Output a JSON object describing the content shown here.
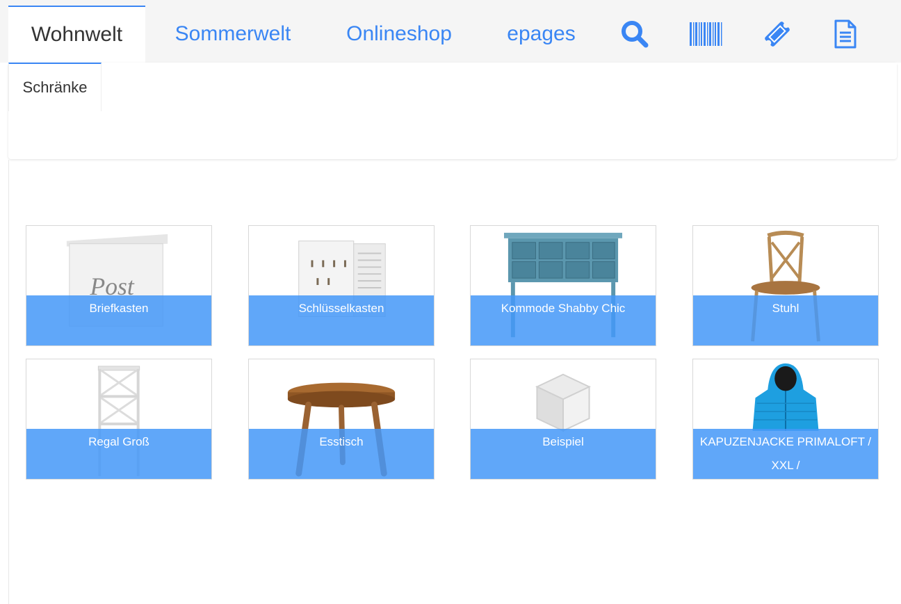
{
  "tabs": [
    {
      "label": "Wohnwelt",
      "active": true
    },
    {
      "label": "Sommerwelt",
      "active": false
    },
    {
      "label": "Onlineshop",
      "active": false
    },
    {
      "label": "epages",
      "active": false
    }
  ],
  "tab_icons": [
    "search-icon",
    "barcode-icon",
    "ticket-icon",
    "document-icon"
  ],
  "subtabs": [
    {
      "label": "Schränke",
      "active": true
    }
  ],
  "products": [
    {
      "name": "Briefkasten",
      "icon": "mailbox-image"
    },
    {
      "name": "Schlüsselkasten",
      "icon": "key-cabinet-image"
    },
    {
      "name": "Kommode Shabby Chic",
      "icon": "dresser-image"
    },
    {
      "name": "Stuhl",
      "icon": "chair-image"
    },
    {
      "name": "Regal Groß",
      "icon": "shelf-image"
    },
    {
      "name": "Esstisch",
      "icon": "stool-image"
    },
    {
      "name": "Beispiel",
      "icon": "placeholder-cube-image"
    },
    {
      "name": "KAPUZENJACKE PRIMALOFT / XXL /",
      "icon": "jacket-image"
    }
  ],
  "colors": {
    "accent": "#3a86f4",
    "label_overlay": "#4498f8",
    "topbar_bg": "#f5f5f5"
  }
}
